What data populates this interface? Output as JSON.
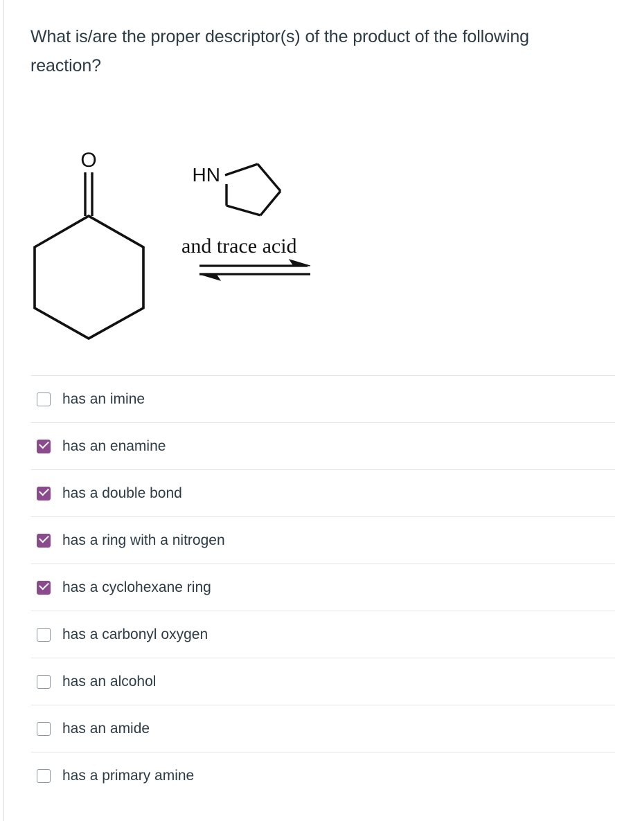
{
  "question": {
    "text": "What is/are the proper descriptor(s) of the product of the following reaction?"
  },
  "reaction": {
    "reagent_label": "HN",
    "carbonyl_label": "O",
    "conditions_text": "and trace acid",
    "arrow_type": "equilibrium-double-arrow",
    "reactant_name": "cyclohexanone",
    "reagent_name": "pyrrolidine"
  },
  "options": [
    {
      "label": "has an imine",
      "checked": false
    },
    {
      "label": "has an enamine",
      "checked": true
    },
    {
      "label": "has a double bond",
      "checked": true
    },
    {
      "label": "has a ring with a nitrogen",
      "checked": true
    },
    {
      "label": "has a cyclohexane ring",
      "checked": true
    },
    {
      "label": "has a carbonyl oxygen",
      "checked": false
    },
    {
      "label": "has an alcohol",
      "checked": false
    },
    {
      "label": "has an amide",
      "checked": false
    },
    {
      "label": "has a primary amine",
      "checked": false
    }
  ],
  "colors": {
    "text": "#2d3b45",
    "checked_accent": "#8b4a8e",
    "unchecked_border": "#8b959e",
    "separator": "#e2e4e7",
    "structure_stroke": "#111111"
  }
}
